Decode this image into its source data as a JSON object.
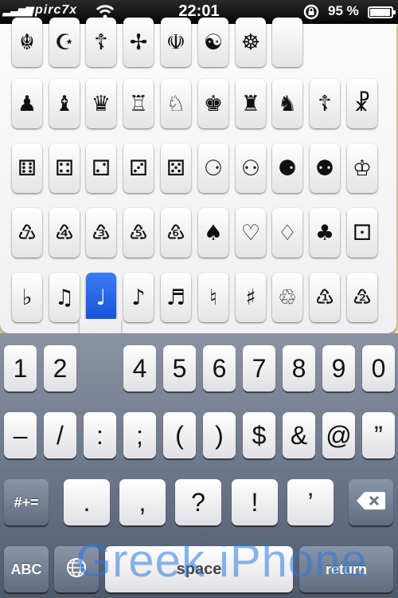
{
  "status_bar": {
    "signal": "▂▃▅▆",
    "carrier": "pirc7x",
    "wifi_icon": "wifi-icon",
    "time": "22:01",
    "lock_icon": "rotation-lock-icon",
    "battery_text": "95 %",
    "battery_level": 0.95
  },
  "symbol_picker": {
    "rows": [
      [
        "☬",
        "☪",
        "☦",
        "✢",
        "☫",
        "☯",
        "☸",
        ""
      ],
      [
        "♟",
        "♝",
        "♛",
        "♖",
        "♘",
        "♚",
        "♜",
        "♞",
        "☦",
        "☧"
      ],
      [
        "⚅",
        "⚃",
        "⚁",
        "⚂",
        "⚄",
        "⚆",
        "⚇",
        "⚈",
        "⚉",
        "♔"
      ],
      [
        "♹",
        "♶",
        "♵",
        "♷",
        "♸",
        "♠",
        "♡",
        "♢",
        "♣",
        "⚀"
      ],
      [
        "♭",
        "♫",
        "♩",
        "♪",
        "♬",
        "♮",
        "♯",
        "♲",
        "♳",
        "♴"
      ]
    ],
    "selected": "♩"
  },
  "keyboard": {
    "row1": [
      "1",
      "2",
      "",
      "4",
      "5",
      "6",
      "7",
      "8",
      "9",
      "0"
    ],
    "row2": [
      "–",
      "/",
      ":",
      ";",
      "(",
      ")",
      "$",
      "&",
      "@",
      "”"
    ],
    "row3": [
      ".",
      ",",
      "?",
      "!",
      "’"
    ],
    "shift_label": "#+=",
    "backspace_icon": "backspace-icon",
    "abc_label": "ABC",
    "globe_icon": "globe-icon",
    "space_label": "space",
    "return_label": "return"
  },
  "watermark": {
    "brand": "Greek iPhone"
  }
}
